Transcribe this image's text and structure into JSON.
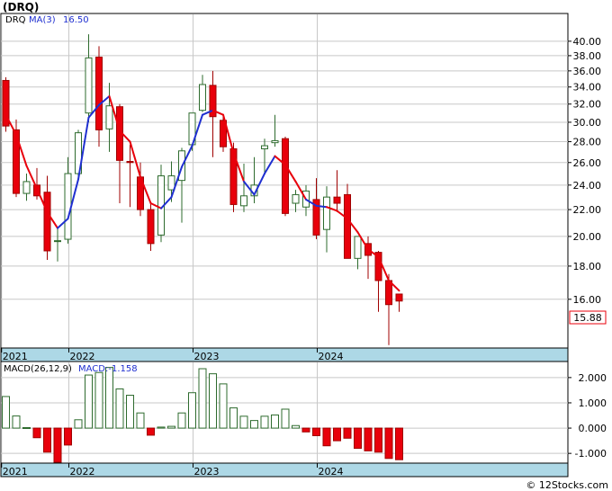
{
  "header": {
    "symbol_label": "(DRQ)",
    "legend_ticker": "DRQ",
    "legend_ma": "MA(3)",
    "legend_ma_value": "16.50",
    "macd_label": "MACD(26,12,9)",
    "macd_value_label": "MACD:-1.158"
  },
  "last_price_label": "15.88",
  "copyright": "© 12Stocks.com",
  "colors": {
    "up": "#ffffff",
    "up_border": "#2e6b2e",
    "down": "#e8000b",
    "down_border": "#a00000",
    "ma_rising": "#1f2fd0",
    "ma_falling": "#e8000b",
    "axis_band": "#add8e6",
    "grid": "#c8c8c8",
    "macd_pos": "#ffffff",
    "macd_pos_border": "#2e6b2e",
    "macd_neg": "#e8000b"
  },
  "chart_data": [
    {
      "type": "candlestick",
      "scale": "log",
      "ylim": [
        13.5,
        44
      ],
      "y_ticks": [
        "16.00",
        "18.00",
        "20.00",
        "22.00",
        "24.00",
        "26.00",
        "28.00",
        "30.00",
        "32.00",
        "34.00",
        "36.00",
        "38.00",
        "40.00"
      ],
      "x_labels": [
        "2021",
        "2022",
        "2023",
        "2024"
      ],
      "x_label_index": [
        0,
        6.5,
        18.5,
        30.5
      ],
      "candles": [
        {
          "o": 34.8,
          "h": 35.2,
          "l": 29.0,
          "c": 29.6
        },
        {
          "o": 29.2,
          "h": 30.3,
          "l": 23.0,
          "c": 23.3
        },
        {
          "o": 23.3,
          "h": 25.0,
          "l": 22.7,
          "c": 24.3
        },
        {
          "o": 24.0,
          "h": 25.5,
          "l": 22.8,
          "c": 23.1
        },
        {
          "o": 23.4,
          "h": 24.8,
          "l": 18.4,
          "c": 19.0
        },
        {
          "o": 19.7,
          "h": 20.6,
          "l": 18.3,
          "c": 19.7
        },
        {
          "o": 19.8,
          "h": 26.5,
          "l": 19.5,
          "c": 25.0
        },
        {
          "o": 25.0,
          "h": 29.2,
          "l": 24.3,
          "c": 28.9
        },
        {
          "o": 31.0,
          "h": 41.0,
          "l": 30.0,
          "c": 37.7
        },
        {
          "o": 37.8,
          "h": 39.3,
          "l": 27.5,
          "c": 29.2
        },
        {
          "o": 29.3,
          "h": 34.5,
          "l": 27.0,
          "c": 31.8
        },
        {
          "o": 31.7,
          "h": 32.0,
          "l": 22.5,
          "c": 26.2
        },
        {
          "o": 26.1,
          "h": 27.7,
          "l": 22.2,
          "c": 26.0
        },
        {
          "o": 24.7,
          "h": 26.0,
          "l": 21.5,
          "c": 22.0
        },
        {
          "o": 22.0,
          "h": 22.5,
          "l": 19.0,
          "c": 19.5
        },
        {
          "o": 20.1,
          "h": 25.8,
          "l": 19.6,
          "c": 24.8
        },
        {
          "o": 23.6,
          "h": 26.1,
          "l": 22.6,
          "c": 24.8
        },
        {
          "o": 24.4,
          "h": 27.4,
          "l": 21.0,
          "c": 27.1
        },
        {
          "o": 27.7,
          "h": 31.0,
          "l": 27.1,
          "c": 31.0
        },
        {
          "o": 31.3,
          "h": 35.5,
          "l": 31.1,
          "c": 34.3
        },
        {
          "o": 34.2,
          "h": 36.0,
          "l": 26.5,
          "c": 30.6
        },
        {
          "o": 30.2,
          "h": 30.8,
          "l": 27.0,
          "c": 27.5
        },
        {
          "o": 27.3,
          "h": 27.9,
          "l": 21.8,
          "c": 22.4
        },
        {
          "o": 22.3,
          "h": 25.9,
          "l": 21.8,
          "c": 23.1
        },
        {
          "o": 23.1,
          "h": 26.5,
          "l": 22.5,
          "c": 24.0
        },
        {
          "o": 27.3,
          "h": 28.3,
          "l": 25.0,
          "c": 27.6
        },
        {
          "o": 27.9,
          "h": 30.8,
          "l": 27.5,
          "c": 28.1
        },
        {
          "o": 28.3,
          "h": 28.5,
          "l": 21.5,
          "c": 21.7
        },
        {
          "o": 22.5,
          "h": 23.6,
          "l": 21.8,
          "c": 23.2
        },
        {
          "o": 22.2,
          "h": 24.0,
          "l": 21.5,
          "c": 23.5
        },
        {
          "o": 22.8,
          "h": 24.6,
          "l": 19.8,
          "c": 20.1
        },
        {
          "o": 20.5,
          "h": 23.9,
          "l": 18.9,
          "c": 23.0
        },
        {
          "o": 23.0,
          "h": 25.3,
          "l": 21.8,
          "c": 22.5
        },
        {
          "o": 23.2,
          "h": 24.1,
          "l": 18.5,
          "c": 18.5
        },
        {
          "o": 18.5,
          "h": 20.0,
          "l": 17.8,
          "c": 20.0
        },
        {
          "o": 19.5,
          "h": 20.0,
          "l": 17.2,
          "c": 18.7
        },
        {
          "o": 18.9,
          "h": 19.0,
          "l": 15.3,
          "c": 17.1
        },
        {
          "o": 17.1,
          "h": 17.5,
          "l": 13.6,
          "c": 15.7
        },
        {
          "o": 16.3,
          "h": 16.3,
          "l": 15.3,
          "c": 15.9
        }
      ],
      "ma": [
        30.8,
        28.7,
        25.7,
        23.7,
        21.8,
        20.6,
        21.3,
        24.5,
        30.5,
        31.9,
        32.9,
        29.1,
        28.0,
        24.7,
        22.5,
        22.1,
        23.0,
        25.6,
        27.6,
        30.8,
        31.3,
        30.8,
        26.9,
        24.3,
        23.2,
        25.0,
        26.6,
        25.8,
        24.3,
        22.8,
        22.3,
        22.2,
        21.9,
        21.3,
        20.3,
        19.1,
        18.6,
        17.1,
        16.5
      ],
      "ma_color": [
        "falling",
        "falling",
        "falling",
        "falling",
        "falling",
        "falling",
        "rising",
        "rising",
        "rising",
        "rising",
        "rising",
        "falling",
        "falling",
        "falling",
        "falling",
        "falling",
        "rising",
        "rising",
        "rising",
        "rising",
        "rising",
        "falling",
        "falling",
        "falling",
        "rising",
        "rising",
        "rising",
        "falling",
        "falling",
        "falling",
        "rising",
        "rising",
        "falling",
        "falling",
        "falling",
        "falling",
        "falling",
        "falling",
        "falling"
      ]
    },
    {
      "type": "bar",
      "title": "MACD(26,12,9)",
      "ylim": [
        -1.35,
        2.6
      ],
      "y_ticks": [
        "-1.000",
        "0.000",
        "1.000",
        "2.000"
      ],
      "x_labels": [
        "2021",
        "2022",
        "2023",
        "2024"
      ],
      "values": [
        1.25,
        0.48,
        0.02,
        -0.38,
        -0.95,
        -1.35,
        -0.67,
        0.33,
        2.1,
        2.2,
        2.4,
        1.55,
        1.3,
        0.6,
        -0.28,
        0.04,
        0.07,
        0.6,
        1.4,
        2.35,
        2.15,
        1.75,
        0.8,
        0.47,
        0.3,
        0.47,
        0.52,
        0.75,
        0.1,
        -0.15,
        -0.3,
        -0.7,
        -0.5,
        -0.4,
        -0.8,
        -0.9,
        -0.95,
        -1.2,
        -1.25
      ]
    }
  ]
}
